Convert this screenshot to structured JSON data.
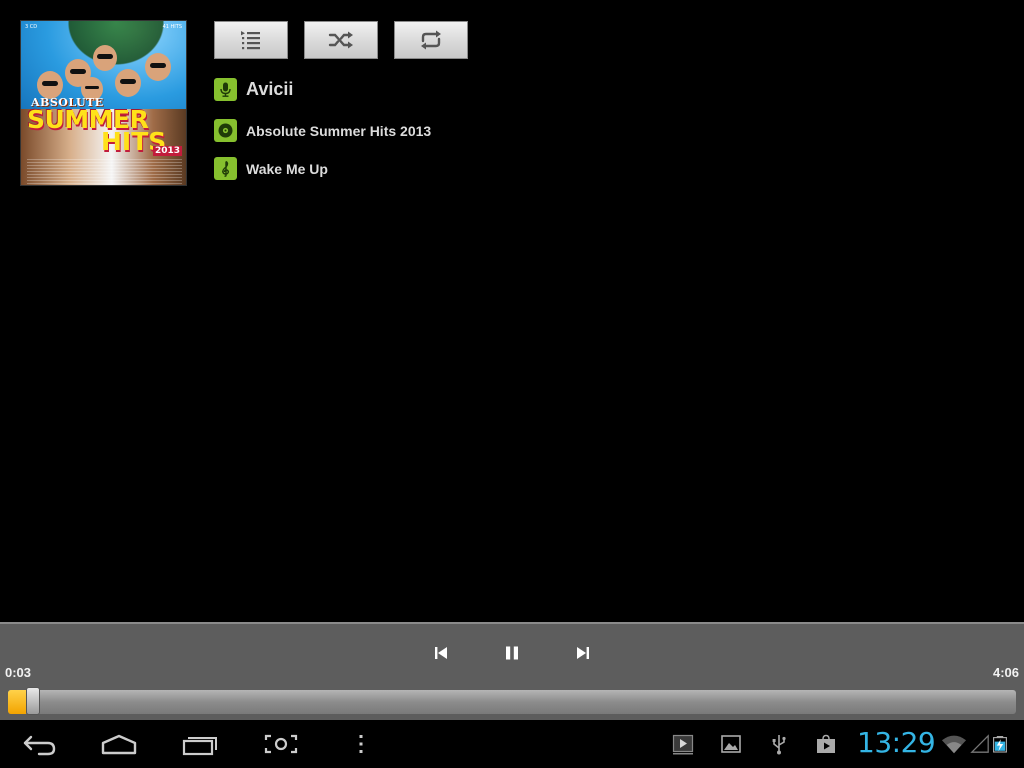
{
  "album_art": {
    "cd_count": "3 CD",
    "hits_count": "41 HITS",
    "word1": "ABSOLUTE",
    "word2": "SUMMER",
    "word3": "HITS",
    "year": "2013"
  },
  "toolbar": {
    "queue_icon": "queue-list-icon",
    "shuffle_icon": "shuffle-icon",
    "repeat_icon": "repeat-icon"
  },
  "track": {
    "artist": "Avicii",
    "album": "Absolute Summer Hits 2013",
    "title": "Wake Me Up"
  },
  "playback": {
    "elapsed": "0:03",
    "total": "4:06",
    "progress_fraction": 0.012,
    "accent_color": "#f2a300"
  },
  "system": {
    "clock": "13:29",
    "clock_color": "#34b5e5"
  }
}
